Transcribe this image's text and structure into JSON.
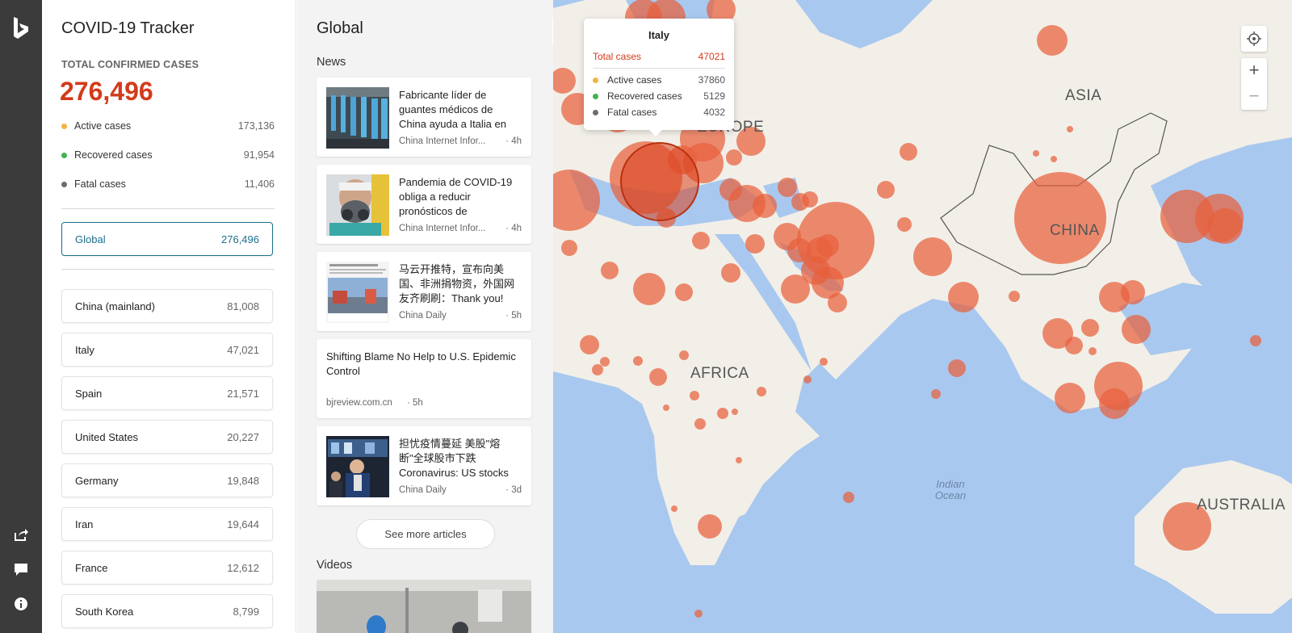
{
  "app": {
    "title": "COVID-19 Tracker"
  },
  "rail": {
    "logo": "bing-logo-icon",
    "buttons": [
      "share-icon",
      "feedback-icon",
      "info-icon"
    ]
  },
  "stats": {
    "total_label": "TOTAL CONFIRMED CASES",
    "total_value": "276,496",
    "rows": [
      {
        "label": "Active cases",
        "value": "173,136",
        "color": "#f0b442"
      },
      {
        "label": "Recovered cases",
        "value": "91,954",
        "color": "#43b14f"
      },
      {
        "label": "Fatal cases",
        "value": "11,406",
        "color": "#6c6c6c"
      }
    ],
    "global": {
      "label": "Global",
      "value": "276,496"
    },
    "regions": [
      {
        "name": "China (mainland)",
        "value": "81,008"
      },
      {
        "name": "Italy",
        "value": "47,021"
      },
      {
        "name": "Spain",
        "value": "21,571"
      },
      {
        "name": "United States",
        "value": "20,227"
      },
      {
        "name": "Germany",
        "value": "19,848"
      },
      {
        "name": "Iran",
        "value": "19,644"
      },
      {
        "name": "France",
        "value": "12,612"
      },
      {
        "name": "South Korea",
        "value": "8,799"
      }
    ]
  },
  "news": {
    "title": "Global",
    "section_label": "News",
    "articles": [
      {
        "headline": "Fabricante líder de guantes médicos de China ayuda a Italia en",
        "source": "China Internet Infor...",
        "age": "· 4h"
      },
      {
        "headline": "Pandemia de COVID-19 obliga a reducir pronósticos de",
        "source": "China Internet Infor...",
        "age": "· 4h"
      },
      {
        "headline": "马云开推特，宣布向美国、非洲捐物资，外国网友齐刷刷：Thank you!",
        "source": "China Daily",
        "age": "· 5h"
      },
      {
        "headline": "Shifting Blame No Help to U.S. Epidemic Control",
        "source": "bjreview.com.cn",
        "age": "· 5h"
      },
      {
        "headline": "担忧疫情蔓延 美股\"熔断\"全球股市下跌 Coronavirus: US stocks",
        "source": "China Daily",
        "age": "· 3d"
      }
    ],
    "see_more": "See more articles",
    "videos_label": "Videos"
  },
  "map": {
    "labels": {
      "europe": "EUROPE",
      "asia": "ASIA",
      "china": "CHINA",
      "africa": "AFRICA",
      "australia": "AUSTRALIA",
      "ocean": "Indian Ocean"
    },
    "bubble_color": "#e8603c",
    "controls": {
      "locate": "locate-icon",
      "zoom_in": "+",
      "zoom_out": "−"
    }
  },
  "tooltip": {
    "title": "Italy",
    "total_label": "Total cases",
    "total_value": "47021",
    "rows": [
      {
        "label": "Active cases",
        "value": "37860",
        "color": "#f0b442"
      },
      {
        "label": "Recovered cases",
        "value": "5129",
        "color": "#43b14f"
      },
      {
        "label": "Fatal cases",
        "value": "4032",
        "color": "#6c6c6c"
      }
    ]
  }
}
